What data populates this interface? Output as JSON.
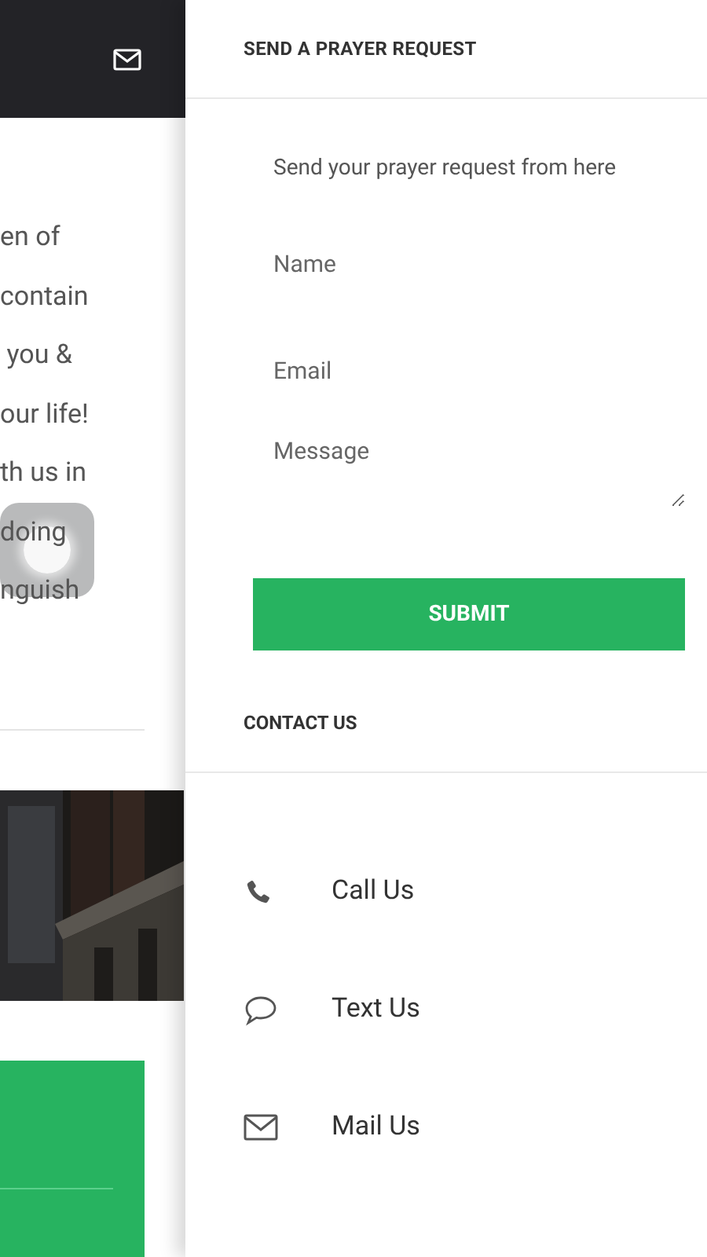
{
  "background_page": {
    "text_lines": [
      "en of",
      "contain",
      " you &",
      "our life!",
      "th us in",
      "doing",
      "nguish"
    ]
  },
  "prayer_request": {
    "title": "SEND A PRAYER REQUEST",
    "intro": "Send your prayer request from here",
    "fields": [
      {
        "kind": "input",
        "placeholder": "Name"
      },
      {
        "kind": "input",
        "placeholder": "Email"
      },
      {
        "kind": "textarea",
        "placeholder": "Message"
      }
    ],
    "submit": "SUBMIT"
  },
  "contact": {
    "title": "CONTACT US",
    "items": [
      {
        "kind": "phone",
        "label": "Call Us"
      },
      {
        "kind": "chat",
        "label": "Text Us"
      },
      {
        "kind": "mail",
        "label": "Mail Us"
      }
    ]
  }
}
